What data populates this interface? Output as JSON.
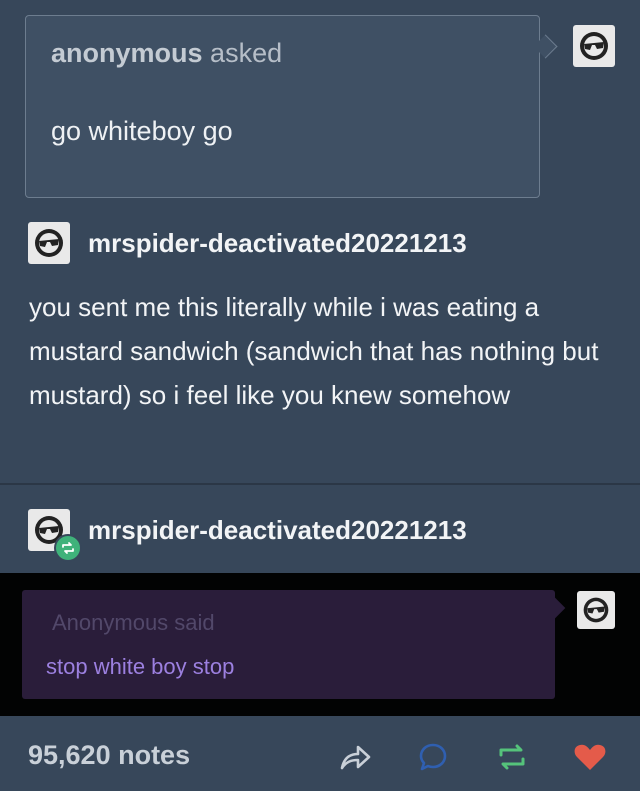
{
  "ask": {
    "asker": "anonymous",
    "verb": "asked",
    "question": "go whiteboy go"
  },
  "post": {
    "username": "mrspider-deactivated20221213",
    "answer": "you sent me this literally while i was eating a mustard sandwich (sandwich that has nothing but mustard) so i feel like you knew somehow"
  },
  "reblog": {
    "username": "mrspider-deactivated20221213",
    "said_header": "Anonymous said",
    "said_body": "stop white boy stop"
  },
  "footer": {
    "notes": "95,620 notes"
  },
  "icons": {
    "avatar": "sunglasses-avatar-icon",
    "reblog_badge": "reblog-badge-icon",
    "share": "share-arrow-icon",
    "reply": "reply-bubble-icon",
    "reblog": "reblog-icon",
    "like": "heart-icon"
  },
  "colors": {
    "background": "#37475a",
    "reblog_green": "#3fb27a",
    "reblog_icon_green": "#55c37b",
    "heart_red": "#e45b4a",
    "said_text_purple": "#9c80e0"
  }
}
